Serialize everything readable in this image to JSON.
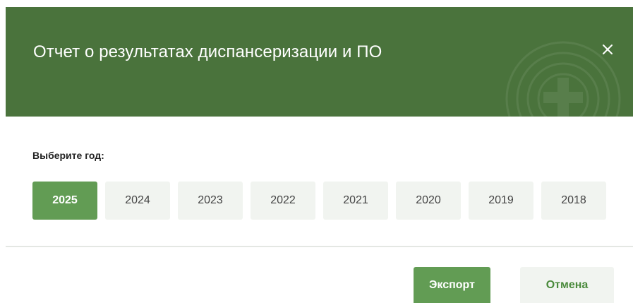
{
  "header": {
    "title": "Отчет о результатах диспансеризации и ПО",
    "close_icon": "close-icon"
  },
  "year_picker": {
    "label": "Выберите год:",
    "selected": "2025",
    "years": [
      "2025",
      "2024",
      "2023",
      "2022",
      "2021",
      "2020",
      "2019",
      "2018"
    ]
  },
  "footer": {
    "export_label": "Экспорт",
    "cancel_label": "Отмена"
  },
  "colors": {
    "header_bg": "#4a733c",
    "accent": "#629c54",
    "button_light_bg": "#f1f4f0"
  }
}
